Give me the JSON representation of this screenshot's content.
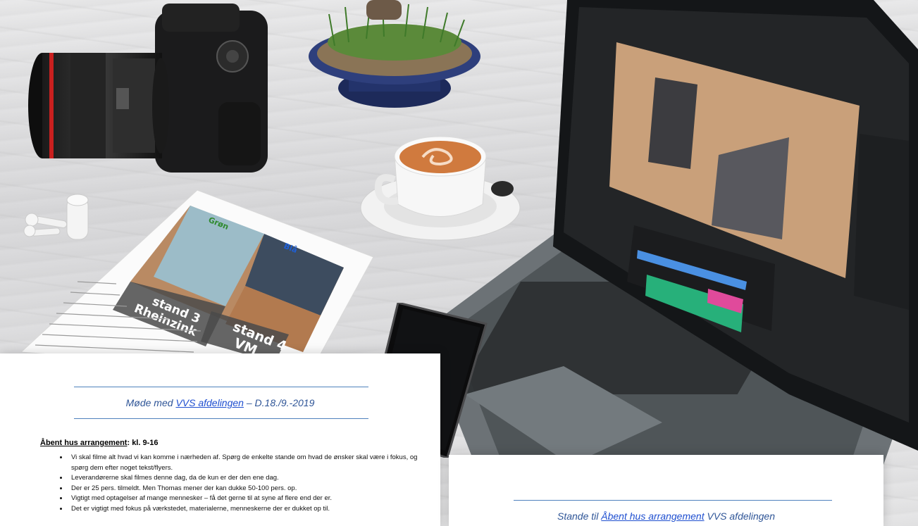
{
  "flyer": {
    "stand3_label": "stand 3\nRheinzink",
    "stand4_label": "stand 4\nVM",
    "tag_green": "Grøn",
    "tag_blue": "Blå"
  },
  "doc_left": {
    "title_prefix": "Møde med ",
    "title_link": "VVS afdelingen",
    "title_suffix": " – D.18./9.-2019",
    "section_label": "Åbent hus arrangement",
    "section_suffix": ": kl. 9-16",
    "bullets": [
      "Vi skal filme alt hvad vi kan komme i nærheden af. Spørg de enkelte stande om hvad de ønsker skal være i fokus, og spørg dem efter noget tekst/flyers.",
      "Leverandørerne skal filmes denne dag, da de kun er der den ene dag.",
      "Der er 25 pers. tilmeldt. Men Thomas mener der kan dukke 50-100 pers. op.",
      "Vigtigt med optagelser af mange mennesker – få det gerne til at syne af flere end der er.",
      "Det er vigtigt med fokus på værkstedet, materialerne, menneskerne der er dukket op til."
    ]
  },
  "doc_right": {
    "title_prefix": "Stande til ",
    "title_link": "Åbent hus arrangement",
    "title_suffix": " VVS afdelingen"
  },
  "colors": {
    "accent_blue": "#2f5597",
    "rule_blue": "#4f81bd",
    "timeline_green": "#27b07a",
    "timeline_pink": "#e04a9b"
  }
}
